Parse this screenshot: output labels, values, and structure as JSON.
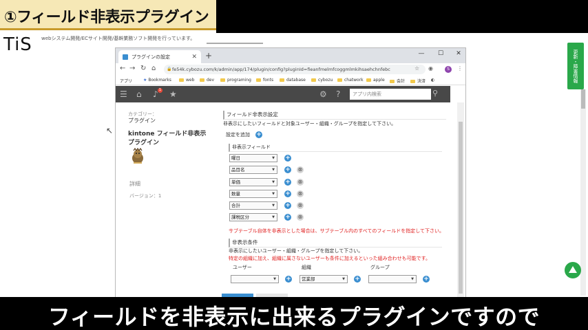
{
  "banner": {
    "title": "①フィールド非表示プラグイン"
  },
  "site": {
    "logo": "TiS",
    "tagline": "webシステム開発/ECサイト開発/基幹業務ソフト開発を行っています。",
    "side_tab": "更新・障害情報"
  },
  "browser": {
    "tab_title": "プラグインの設定",
    "url": "fe54k.cybozu.com/k/admin/app/174/plugin/config?pluginId=fieanfmelmfcoggmlmkihsaehchnfebc",
    "avatar_letter": "S",
    "bookmarks": [
      "アプリ",
      "Bookmarks",
      "web",
      "dev",
      "programing",
      "fonts",
      "database",
      "cybozu",
      "chatwork",
      "apple",
      "会計",
      "決済"
    ]
  },
  "kintone": {
    "notification_count": "1",
    "search_placeholder": "アプリ内検索"
  },
  "plugin": {
    "category_label": "カテゴリー：",
    "category_value": "プラグイン",
    "name": "kintone フィールド非表示プラグイン",
    "detail": "詳細",
    "version": "バージョン：1"
  },
  "settings": {
    "section_title": "フィールド非表示設定",
    "section_desc": "非表示にしたいフィールドと対象ユーザー・組織・グループを指定して下さい。",
    "add_label": "設定を追加",
    "fields_title": "非表示フィールド",
    "fields": [
      "曜日",
      "品目名",
      "単価",
      "数量",
      "合計",
      "課税区分"
    ],
    "subtable_note": "サブテーブル自体を非表示とした場合は、サブテーブル内のすべてのフィールドを指定して下さい。",
    "condition_title": "非表示条件",
    "condition_desc": "非表示にしたいユーザー・組織・グループを指定して下さい。",
    "condition_note": "特定の組織に加え、組織に属さないユーザーも条件に加えるといった組み合わせも可能です。",
    "columns": [
      "ユーザー",
      "組織",
      "グループ"
    ],
    "user_value": "",
    "org_value": "営業部",
    "group_value": ""
  },
  "caption": "フィールドを非表示に出来るプラグインですので",
  "colors": {
    "brand_green": "#2aa84a",
    "accent_blue": "#3a8ed0",
    "warning_red": "#e02020"
  }
}
